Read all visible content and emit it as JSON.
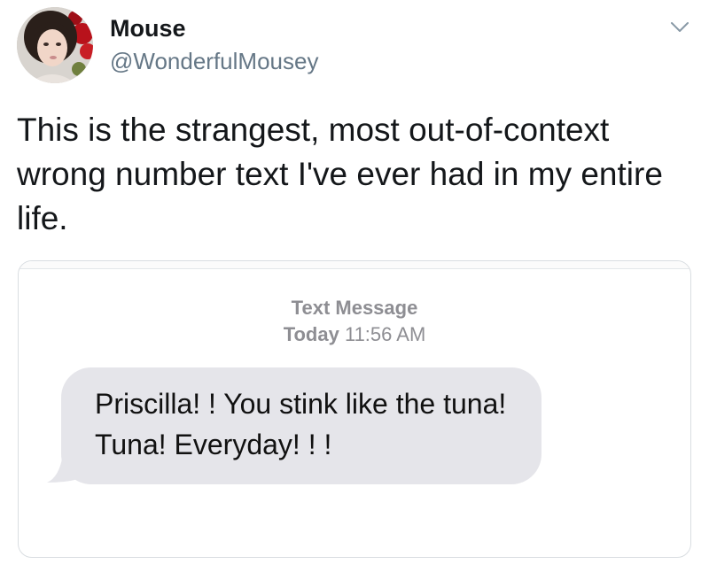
{
  "tweet": {
    "display_name": "Mouse",
    "handle": "@WonderfulMousey",
    "text": "This is the strangest, most out-of-context wrong number text I've ever had in my entire life."
  },
  "icons": {
    "more_menu": "chevron-down-icon",
    "avatar": "profile-photo"
  },
  "message_screenshot": {
    "service_label": "Text Message",
    "day_label": "Today",
    "time_label": "11:56 AM",
    "bubble_text": "Priscilla! ! You stink like the tuna! Tuna! Everyday! ! !"
  },
  "colors": {
    "text_primary": "#14171a",
    "text_secondary": "#657786",
    "bubble_gray": "#e5e5ea",
    "imessage_label_gray": "#8e8e93"
  }
}
